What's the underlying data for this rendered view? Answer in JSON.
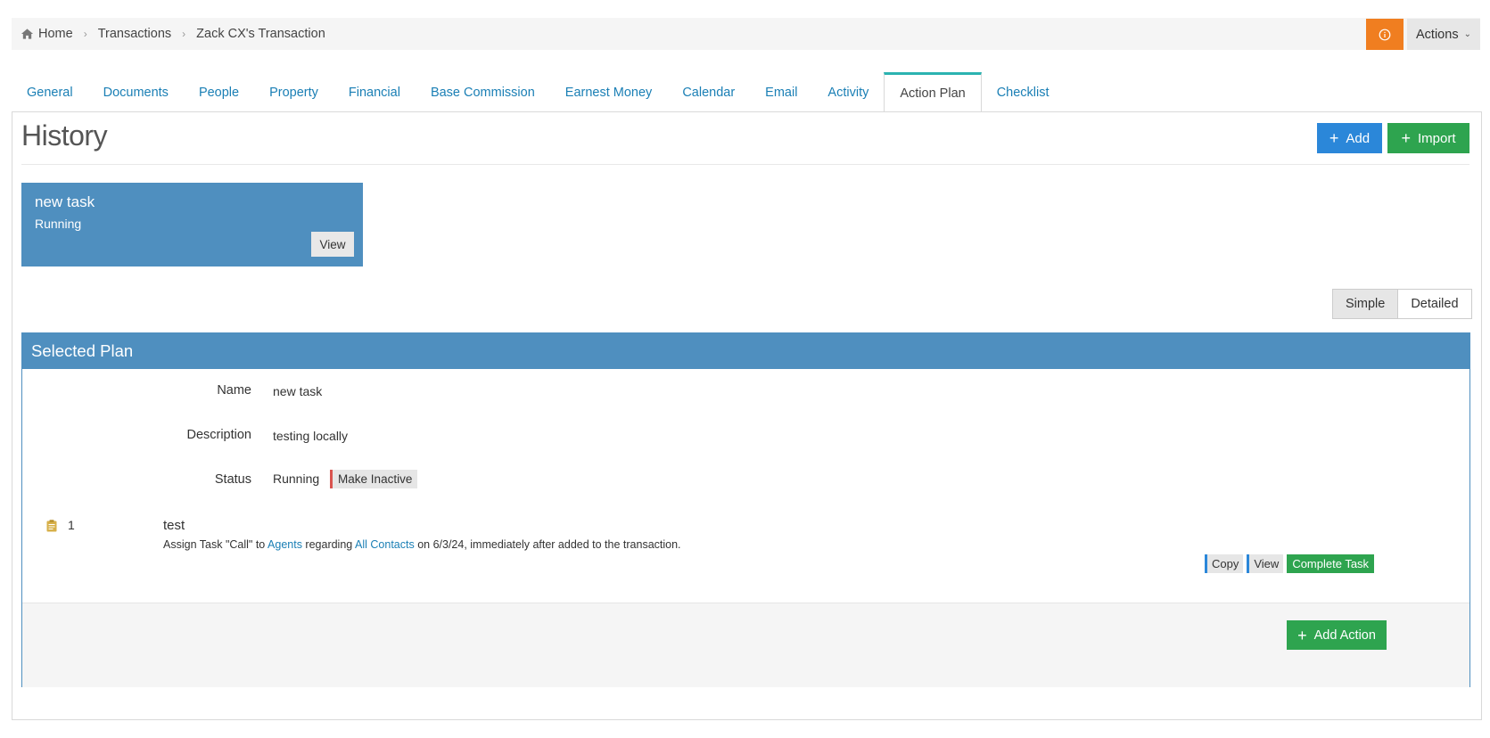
{
  "breadcrumb": {
    "items": [
      "Home",
      "Transactions",
      "Zack CX's Transaction"
    ]
  },
  "header": {
    "actions_label": "Actions",
    "info_color": "#f07e20"
  },
  "tabs": [
    {
      "label": "General"
    },
    {
      "label": "Documents"
    },
    {
      "label": "People"
    },
    {
      "label": "Property"
    },
    {
      "label": "Financial"
    },
    {
      "label": "Base Commission"
    },
    {
      "label": "Earnest Money"
    },
    {
      "label": "Calendar"
    },
    {
      "label": "Email"
    },
    {
      "label": "Activity"
    },
    {
      "label": "Action Plan",
      "active": true
    },
    {
      "label": "Checklist"
    }
  ],
  "history": {
    "title": "History",
    "add_label": "Add",
    "import_label": "Import",
    "plan_card": {
      "name": "new task",
      "status": "Running",
      "view_label": "View"
    }
  },
  "view_toggle": {
    "options": [
      "Simple",
      "Detailed"
    ],
    "selected": "Simple"
  },
  "selected_plan": {
    "header": "Selected Plan",
    "fields": {
      "name_label": "Name",
      "name_value": "new task",
      "description_label": "Description",
      "description_value": "testing locally",
      "status_label": "Status",
      "status_value": "Running",
      "make_inactive_label": "Make Inactive"
    },
    "tasks": [
      {
        "number": "1",
        "title": "test",
        "desc_prefix": "Assign Task \"Call\" to ",
        "desc_link1": "Agents",
        "desc_mid": " regarding ",
        "desc_link2": "All Contacts",
        "desc_suffix": " on 6/3/24, immediately after added to the transaction.",
        "copy_label": "Copy",
        "view_label": "View",
        "complete_label": "Complete Task"
      }
    ],
    "add_action_label": "Add Action"
  },
  "colors": {
    "primary_blue": "#2b87d9",
    "panel_blue": "#4f8fbf",
    "success_green": "#2ea44f",
    "tab_accent": "#2bb3b1",
    "danger_red": "#d9534f"
  }
}
